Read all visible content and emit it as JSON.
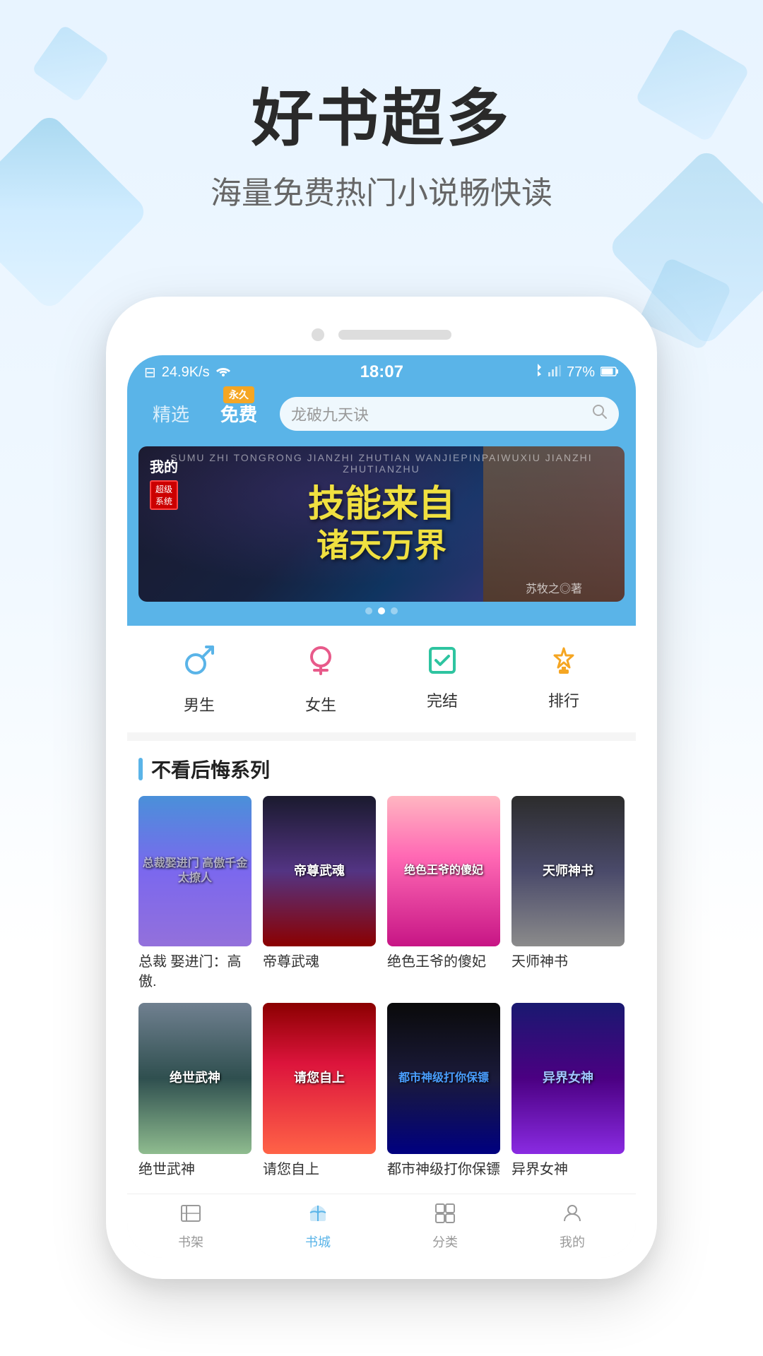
{
  "hero": {
    "title": "好书超多",
    "subtitle": "海量免费热门小说畅快读"
  },
  "status_bar": {
    "signal": "24.9K/s",
    "wifi": "WiFi",
    "time": "18:07",
    "bluetooth": "BT",
    "battery_percent": "77%"
  },
  "nav": {
    "tabs": [
      {
        "label": "精选",
        "active": false
      },
      {
        "label": "免费",
        "active": true,
        "badge": "永久"
      }
    ],
    "search_placeholder": "龙破九天诀"
  },
  "banner": {
    "title_line1": "我的",
    "title_line2": "技能来自",
    "title_line3": "诸天万界",
    "label_superclub": "超级系统",
    "author": "苏牧之◎著"
  },
  "categories": [
    {
      "id": "male",
      "label": "男生",
      "icon": "♂"
    },
    {
      "id": "female",
      "label": "女生",
      "icon": "♀"
    },
    {
      "id": "complete",
      "label": "完结",
      "icon": "📖"
    },
    {
      "id": "rank",
      "label": "排行",
      "icon": "🏆"
    }
  ],
  "section": {
    "title": "不看后悔系列",
    "books": [
      {
        "id": 1,
        "title": "总裁 娶进门：高傲.",
        "cover_class": "cover-1",
        "cover_text": "总裁娶进门 高傲千金太撩人"
      },
      {
        "id": 2,
        "title": "帝尊武魂",
        "cover_class": "cover-2",
        "cover_text": "帝尊武魂"
      },
      {
        "id": 3,
        "title": "绝色王爷的傻妃",
        "cover_class": "cover-3",
        "cover_text": "绝色王爷的傻妃"
      },
      {
        "id": 4,
        "title": "天师神书",
        "cover_class": "cover-4",
        "cover_text": "天师神书"
      },
      {
        "id": 5,
        "title": "绝世武神",
        "cover_class": "cover-5",
        "cover_text": "绝世武神"
      },
      {
        "id": 6,
        "title": "请您自上",
        "cover_class": "cover-6",
        "cover_text": "请您自上"
      },
      {
        "id": 7,
        "title": "都市神级打你保镖",
        "cover_class": "cover-7",
        "cover_text": "都市神级打你保镖"
      },
      {
        "id": 8,
        "title": "异界女神",
        "cover_class": "cover-8",
        "cover_text": "异界女神"
      }
    ]
  },
  "bottom_nav": [
    {
      "id": "bookshelf",
      "label": "书架",
      "active": false,
      "icon": "▣"
    },
    {
      "id": "bookstore",
      "label": "书城",
      "active": true,
      "icon": "📖"
    },
    {
      "id": "category",
      "label": "分类",
      "active": false,
      "icon": "⊞"
    },
    {
      "id": "mine",
      "label": "我的",
      "active": false,
      "icon": "👤"
    }
  ]
}
